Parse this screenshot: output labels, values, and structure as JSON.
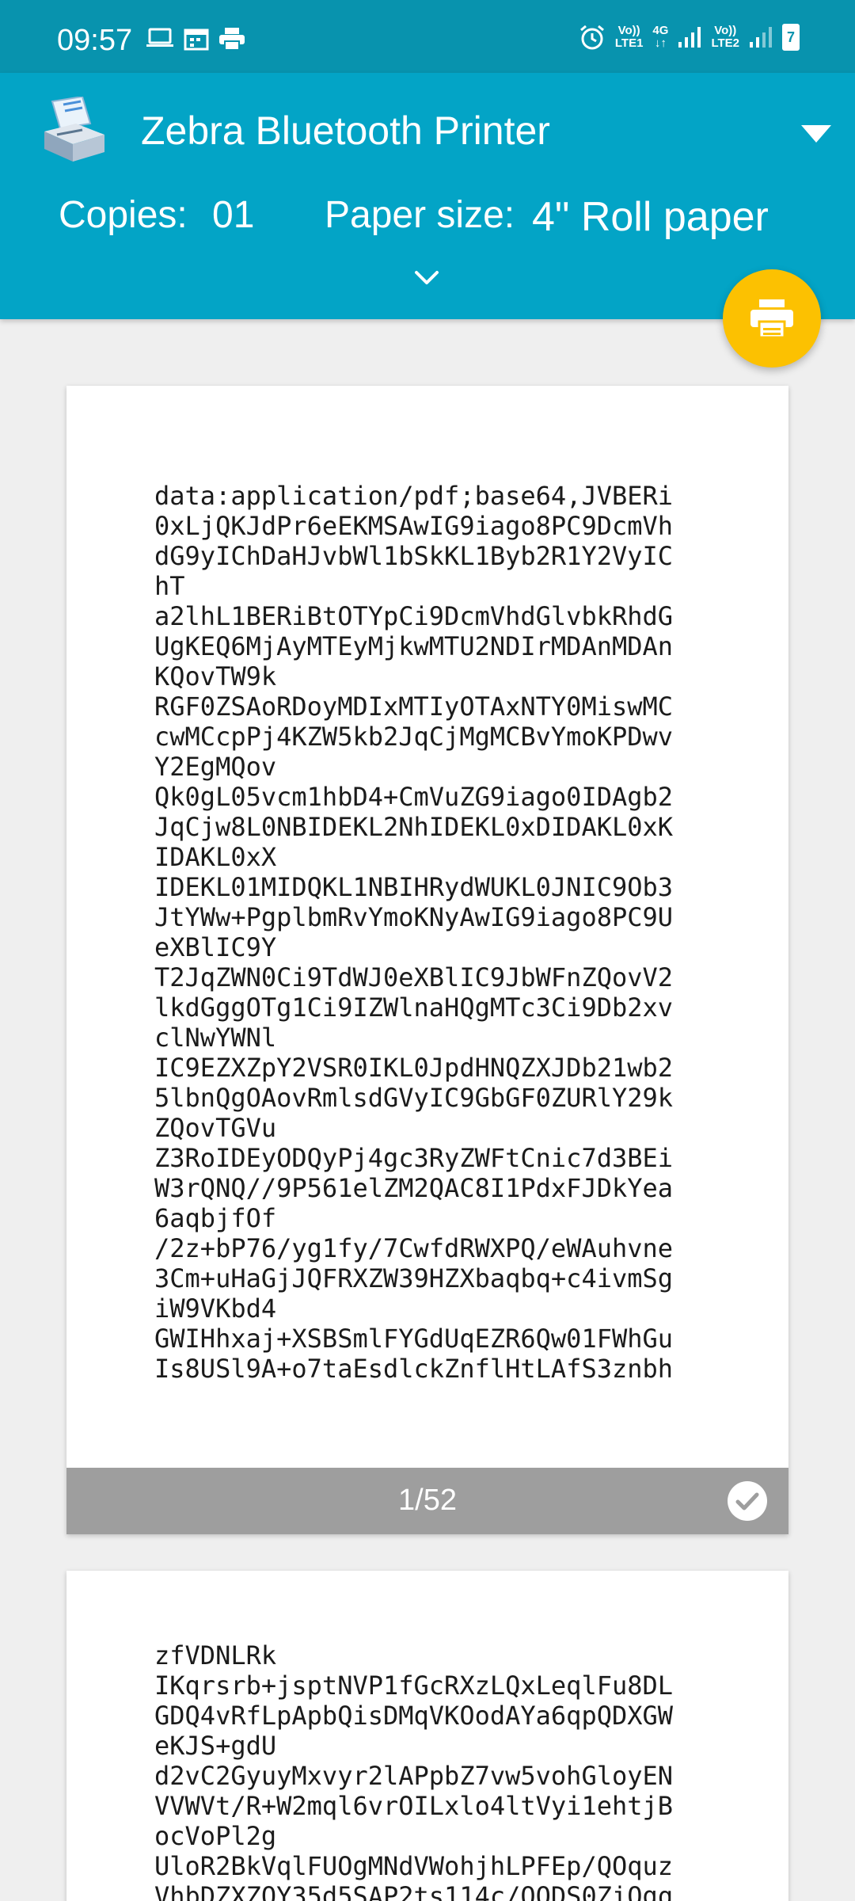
{
  "status_bar": {
    "time": "09:57",
    "sim1_top": "Vo))",
    "sim1_bottom": "LTE1",
    "net_type": "4G",
    "sim2_top": "Vo))",
    "sim2_bottom": "LTE2",
    "battery_level": "7"
  },
  "toolbar": {
    "printer_name": "Zebra Bluetooth Printer",
    "copies_label": "Copies:",
    "copies_value": "01",
    "paper_size_label": "Paper size:",
    "paper_size_value": "4\" Roll paper"
  },
  "pages": [
    {
      "text": "data:application/pdf;base64,JVBERi\n0xLjQKJdPr6eEKMSAwIG9iago8PC9DcmVh\ndG9yIChDaHJvbWl1bSkKL1Byb2R1Y2VyIC\nhT\na2lhL1BERiBtOTYpCi9DcmVhdGlvbkRhdG\nUgKEQ6MjAyMTEyMjkwMTU2NDIrMDAnMDAn\nKQovTW9k\nRGF0ZSAoRDoyMDIxMTIyOTAxNTY0MiswMC\ncwMCcpPj4KZW5kb2JqCjMgMCBvYmoKPDwv\nY2EgMQov\nQk0gL05vcm1hbD4+CmVuZG9iago0IDAgb2\nJqCjw8L0NBIDEKL2NhIDEKL0xDIDAKL0xK\nIDAKL0xX\nIDEKL01MIDQKL1NBIHRydWUKL0JNIC9Ob3\nJtYWw+PgplbmRvYmoKNyAwIG9iago8PC9U\neXBlIC9Y\nT2JqZWN0Ci9TdWJ0eXBlIC9JbWFnZQovV2\nlkdGggOTg1Ci9IZWlnaHQgMTc3Ci9Db2xv\nclNwYWNl\nIC9EZXZpY2VSR0IKL0JpdHNQZXJDb21wb2\n5lbnQgOAovRmlsdGVyIC9GbGF0ZURlY29k\nZQovTGVu\nZ3RoIDEyODQyPj4gc3RyZWFtCnic7d3BEi\nW3rQNQ//9P561elZM2QAC8I1PdxFJDkYea\n6aqbjfOf\n/2z+bP76/yg1fy/7CwfdRWXPQ/eWAuhvne\n3Cm+uHaGjJQFRXZW39HZXbaqbq+c4ivmSg\niW9VKbd4\nGWIHhxaj+XSBSmlFYGdUqEZR6Qw01FWhGu\nIs8USl9A+o7taEsdlckZnflHtLAfS3znbh",
      "number": "1/52"
    },
    {
      "text": "zfVDNLRk\nIKqrsrb+jsptNVP1fGcRXzLQxLeqlFu8DL\nGDQ4vRfLpApbQisDMqVKOodAYa6qpQDXGW\neKJS+gdU\nd2vC2GyuyMxvyr2lAPpbZ7vw5vohGloyEN\nVVWVt/R+W2mql6vrOILxlo4ltVyi1ehtjB\nocVoPl2g\nUloR2BkVqlFUOgMNdVWohjhLPFEp/QOquz\nVhbDZXZOY35d5SAP2ts114c/OODS0ZiQgq"
    }
  ],
  "colors": {
    "status_bar": "#0893ae",
    "toolbar": "#03a4c6",
    "fab": "#fcc101",
    "page_footer": "#9e9e9e",
    "background": "#efefef"
  }
}
